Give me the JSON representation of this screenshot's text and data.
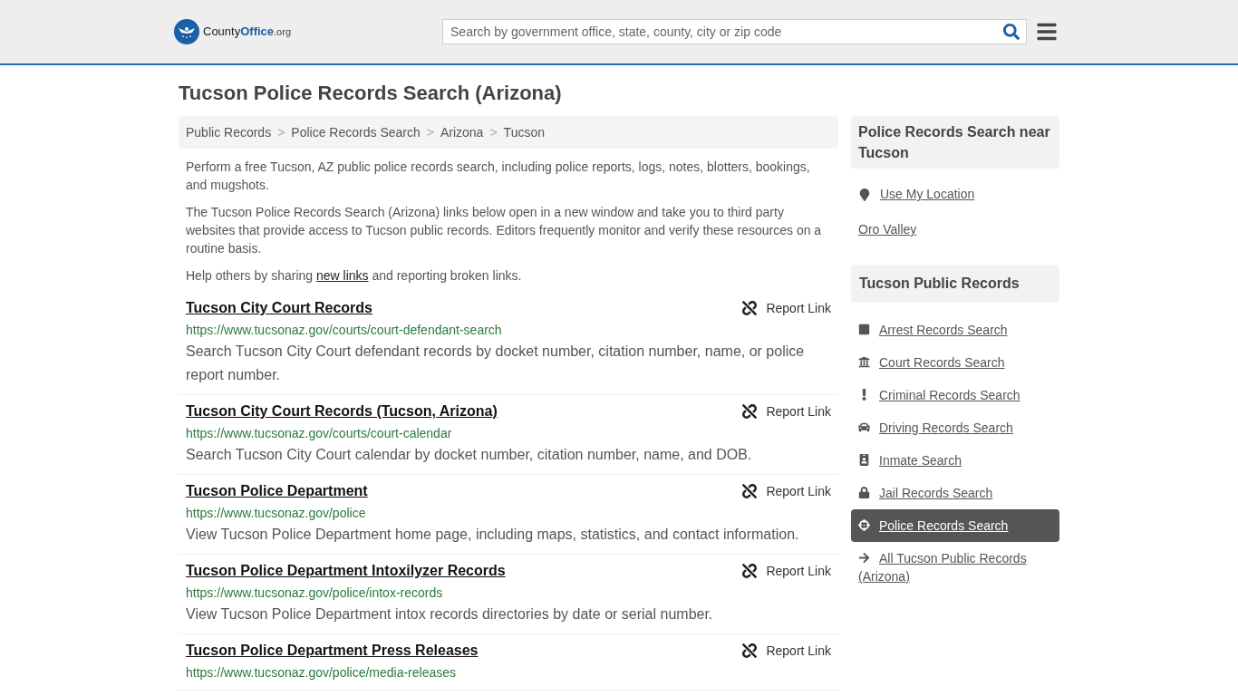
{
  "header": {
    "logo": {
      "part_1": "County",
      "part_2": "Office",
      "part_3": ".org"
    },
    "search": {
      "placeholder": "Search by government office, state, county, city or zip code"
    }
  },
  "title": "Tucson Police Records Search (Arizona)",
  "breadcrumbs": [
    "Public Records",
    "Police Records Search",
    "Arizona",
    "Tucson"
  ],
  "breadcrumb_separator": ">",
  "intro": [
    "Perform a free Tucson, AZ public police records search, including police reports, logs, notes, blotters, bookings, and mugshots.",
    "The Tucson Police Records Search (Arizona) links below open in a new window and take you to third party websites that provide access to Tucson public records. Editors frequently monitor and verify these resources on a routine basis."
  ],
  "share": {
    "before": "Help others by sharing",
    "link": "new links",
    "after": "and reporting broken links."
  },
  "results": [
    {
      "title": "Tucson City Court Records",
      "url": "https://www.tucsonaz.gov/courts/court-defendant-search",
      "description": "Search Tucson City Court defendant records by docket number, citation number, name, or police report number.",
      "report": "Report Link"
    },
    {
      "title": "Tucson City Court Records (Tucson, Arizona)",
      "url": "https://www.tucsonaz.gov/courts/court-calendar",
      "description": "Search Tucson City Court calendar by docket number, citation number, name, and DOB.",
      "report": "Report Link"
    },
    {
      "title": "Tucson Police Department",
      "url": "https://www.tucsonaz.gov/police",
      "description": "View Tucson Police Department home page, including maps, statistics, and contact information.",
      "report": "Report Link"
    },
    {
      "title": "Tucson Police Department Intoxilyzer Records",
      "url": "https://www.tucsonaz.gov/police/intox-records",
      "description": "View Tucson Police Department intox records directories by date or serial number.",
      "report": "Report Link"
    },
    {
      "title": "Tucson Police Department Press Releases",
      "url": "https://www.tucsonaz.gov/police/media-releases",
      "report": "Report Link"
    }
  ],
  "nearby": {
    "heading": "Police Records Search near Tucson",
    "location": "Use My Location",
    "places": [
      "Oro Valley"
    ]
  },
  "public_records": {
    "heading": "Tucson Public Records",
    "items": [
      {
        "kind": "arrest",
        "label": "Arrest Records Search",
        "selected": false
      },
      {
        "kind": "court",
        "label": "Court Records Search",
        "selected": false
      },
      {
        "kind": "criminal",
        "label": "Criminal Records Search",
        "selected": false
      },
      {
        "kind": "driving",
        "label": "Driving Records Search",
        "selected": false
      },
      {
        "kind": "inmate",
        "label": "Inmate Search",
        "selected": false
      },
      {
        "kind": "jail",
        "label": "Jail Records Search",
        "selected": false
      },
      {
        "kind": "police",
        "label": "Police Records Search",
        "selected": true
      },
      {
        "kind": "all",
        "label": "All Tucson Public Records (Arizona)",
        "selected": false
      }
    ]
  }
}
